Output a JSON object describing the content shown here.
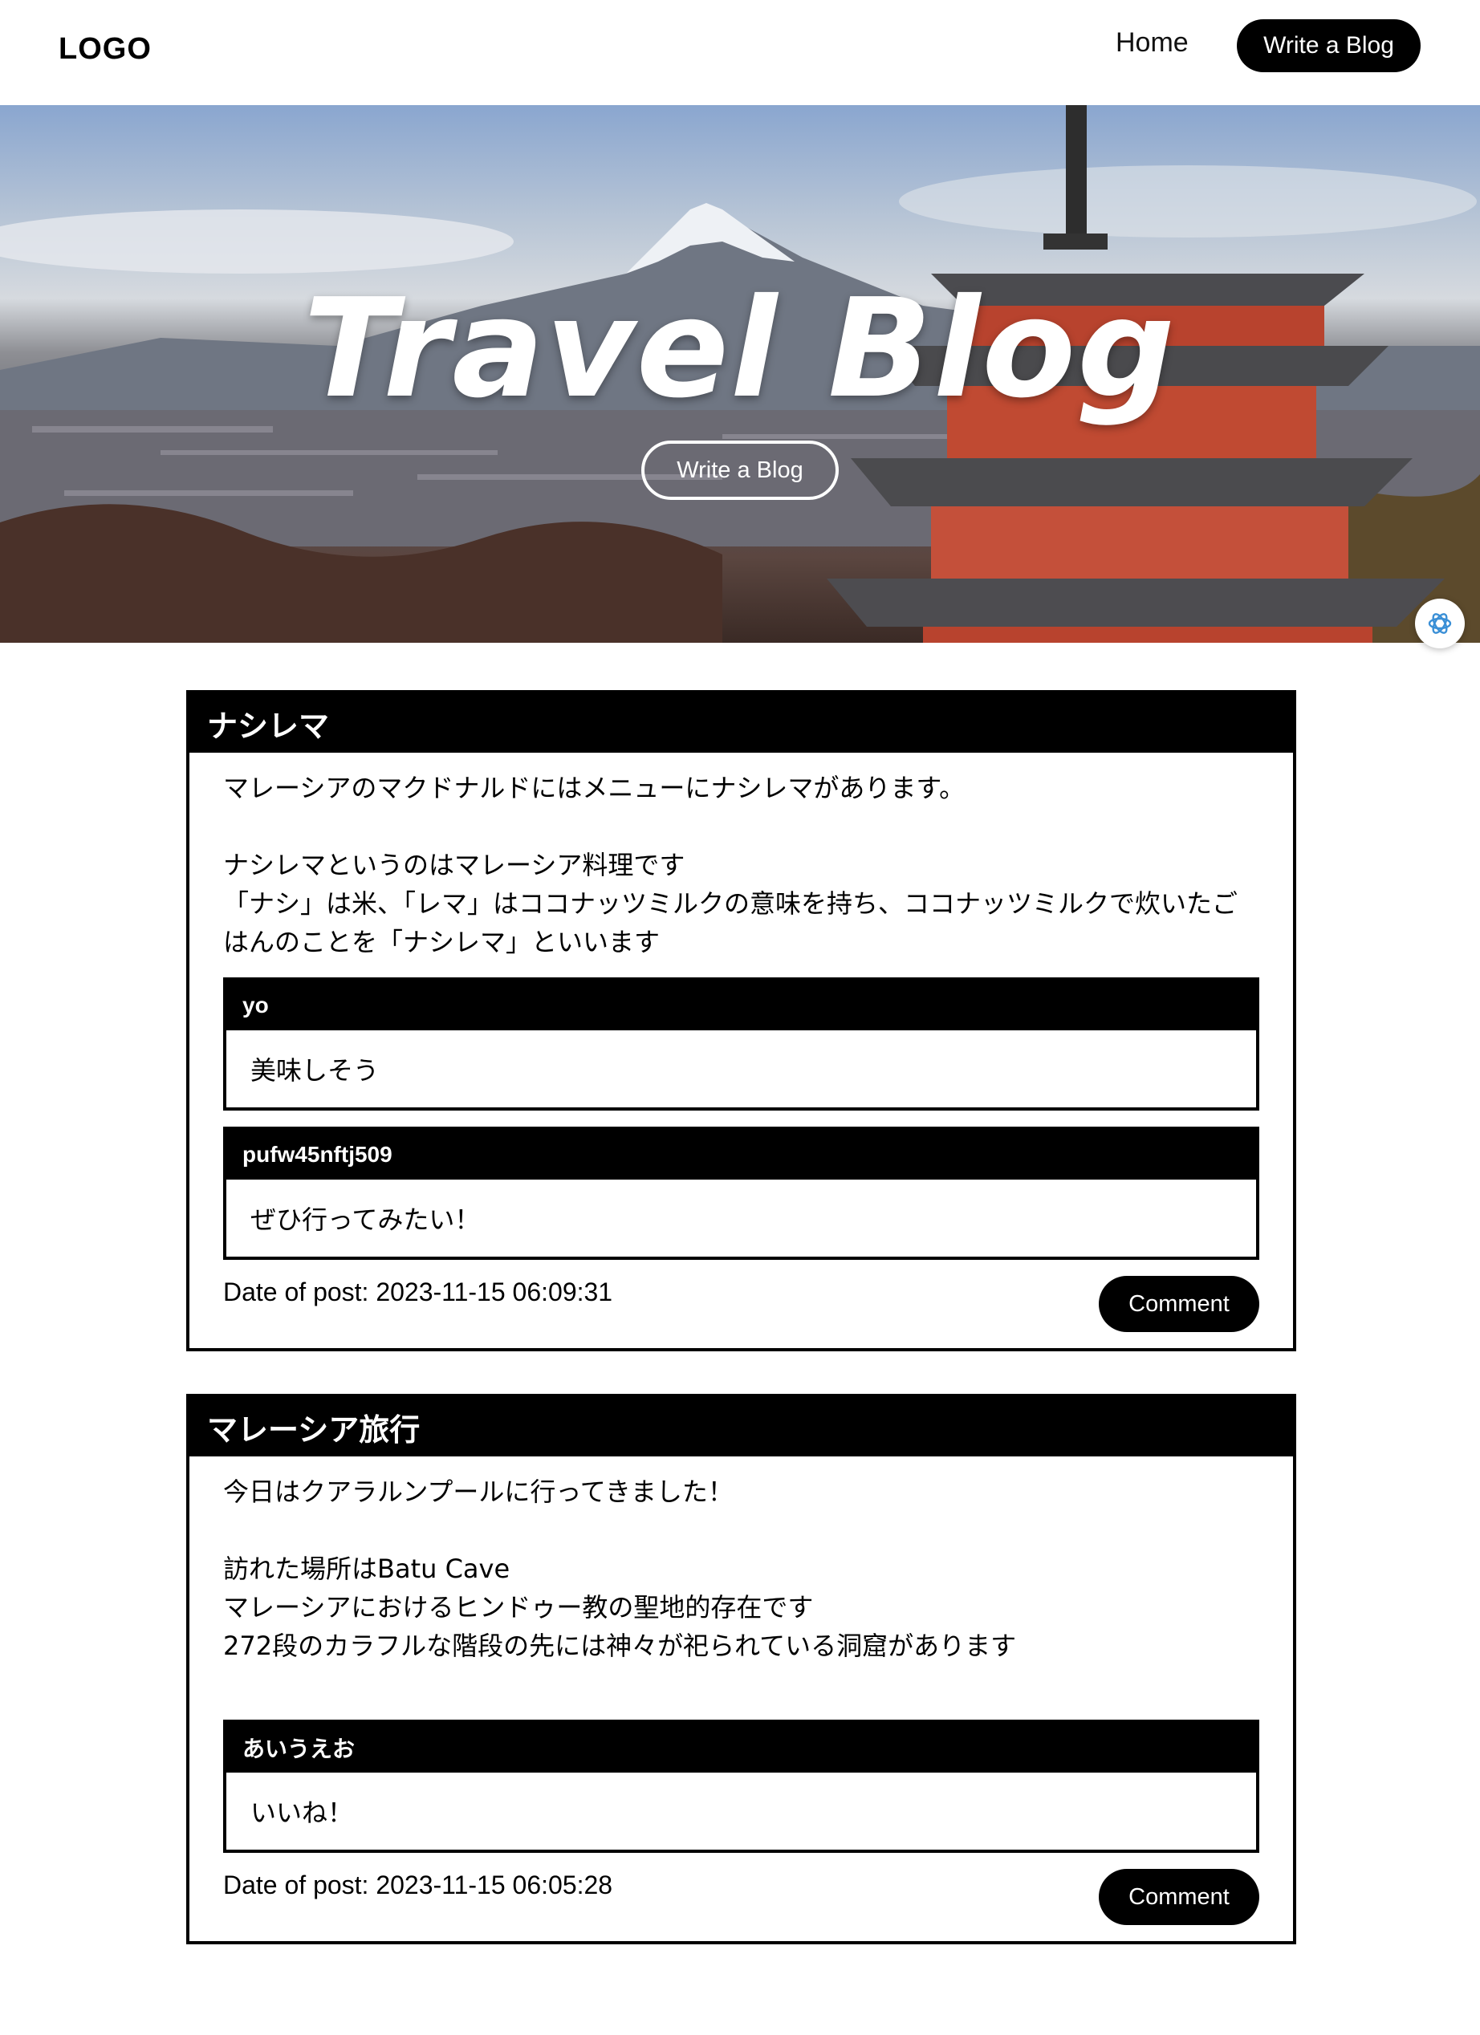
{
  "header": {
    "logo": "LOGO",
    "nav_home": "Home",
    "nav_write": "Write a Blog"
  },
  "hero": {
    "title": "Travel Blog",
    "button": "Write a Blog"
  },
  "posts": [
    {
      "title": "ナシレマ",
      "body": [
        "マレーシアのマクドナルドにはメニューにナシレマがあります。",
        "",
        "ナシレマというのはマレーシア料理です",
        "「ナシ」は米、「レマ」はココナッツミルクの意味を持ち、ココナッツミルクで炊いたご",
        "はんのことを「ナシレマ」といいます"
      ],
      "comments": [
        {
          "user": "yo",
          "text": "美味しそう"
        },
        {
          "user": "pufw45nftj509",
          "text": "ぜひ行ってみたい！"
        }
      ],
      "date": "Date of post: 2023-11-15 06:09:31",
      "comment_button": "Comment"
    },
    {
      "title": "マレーシア旅行",
      "body": [
        "今日はクアラルンプールに行ってきました！",
        "",
        "訪れた場所はBatu Cave",
        "マレーシアにおけるヒンドゥー教の聖地的存在です",
        "272段のカラフルな階段の先には神々が祀られている洞窟があります",
        ""
      ],
      "comments": [
        {
          "user": "あいうえお",
          "text": "いいね！"
        }
      ],
      "date": "Date of post: 2023-11-15 06:05:28",
      "comment_button": "Comment"
    }
  ]
}
